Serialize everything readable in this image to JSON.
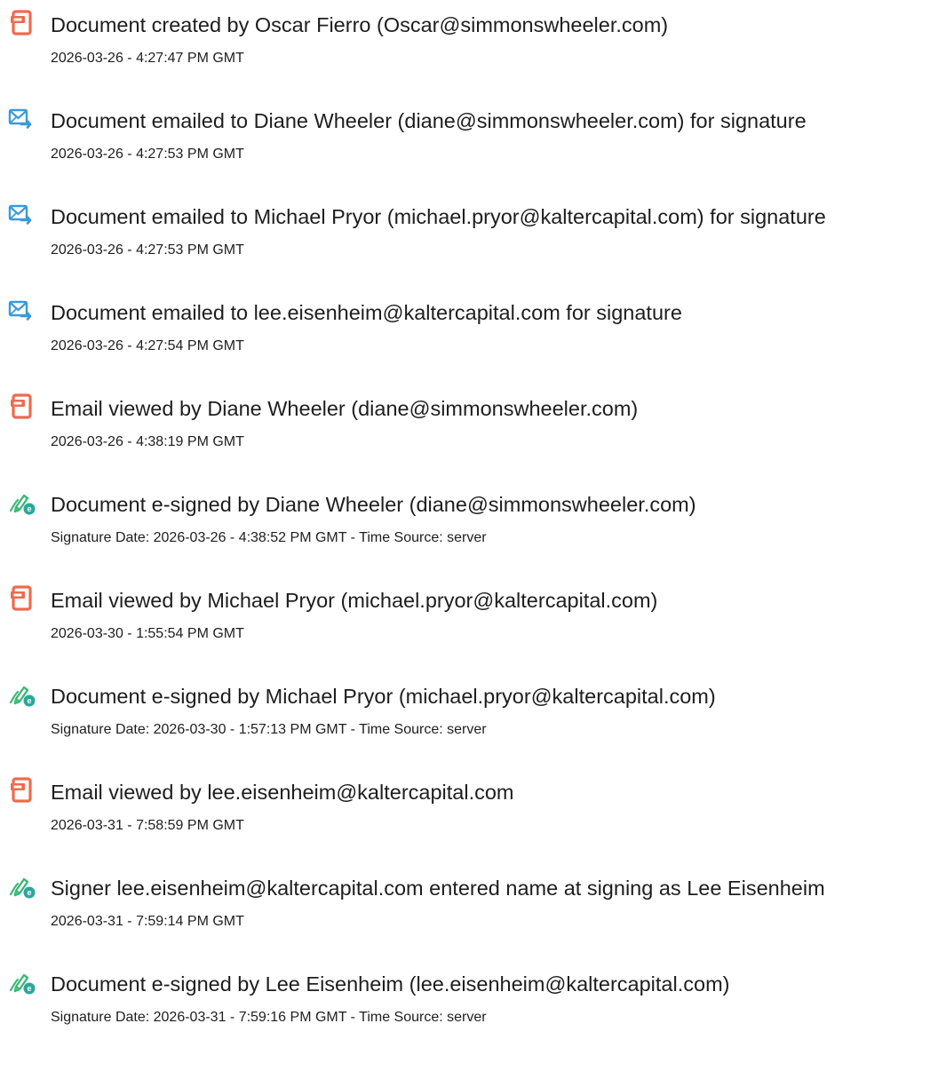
{
  "events": [
    {
      "icon": "document-created-icon",
      "title": "Document created by Oscar Fierro (Oscar@simmonswheeler.com)",
      "detail": "2026-03-26 - 4:27:47 PM GMT"
    },
    {
      "icon": "email-sent-icon",
      "title": "Document emailed to Diane Wheeler (diane@simmonswheeler.com) for signature",
      "detail": "2026-03-26 - 4:27:53 PM GMT"
    },
    {
      "icon": "email-sent-icon",
      "title": "Document emailed to Michael Pryor (michael.pryor@kaltercapital.com) for signature",
      "detail": "2026-03-26 - 4:27:53 PM GMT"
    },
    {
      "icon": "email-sent-icon",
      "title": "Document emailed to lee.eisenheim@kaltercapital.com for signature",
      "detail": "2026-03-26 - 4:27:54 PM GMT"
    },
    {
      "icon": "document-viewed-icon",
      "title": "Email viewed by Diane Wheeler (diane@simmonswheeler.com)",
      "detail": "2026-03-26 - 4:38:19 PM GMT"
    },
    {
      "icon": "e-signed-icon",
      "title": "Document e-signed by Diane Wheeler (diane@simmonswheeler.com)",
      "detail": "Signature Date: 2026-03-26 - 4:38:52 PM GMT - Time Source: server"
    },
    {
      "icon": "document-viewed-icon",
      "title": "Email viewed by Michael Pryor (michael.pryor@kaltercapital.com)",
      "detail": "2026-03-30 - 1:55:54 PM GMT"
    },
    {
      "icon": "e-signed-icon",
      "title": "Document e-signed by Michael Pryor (michael.pryor@kaltercapital.com)",
      "detail": "Signature Date: 2026-03-30 - 1:57:13 PM GMT - Time Source: server"
    },
    {
      "icon": "document-viewed-icon",
      "title": "Email viewed by lee.eisenheim@kaltercapital.com",
      "detail": "2026-03-31 - 7:58:59 PM GMT"
    },
    {
      "icon": "e-signed-icon",
      "title": "Signer lee.eisenheim@kaltercapital.com entered name at signing as Lee Eisenheim",
      "detail": "2026-03-31 - 7:59:14 PM GMT"
    },
    {
      "icon": "e-signed-icon",
      "title": "Document e-signed by Lee Eisenheim (lee.eisenheim@kaltercapital.com)",
      "detail": "Signature Date: 2026-03-31 - 7:59:16 PM GMT - Time Source: server"
    }
  ],
  "colors": {
    "document_icon": "#ee6b4d",
    "email_icon": "#3a9ad9",
    "sign_icon_pen": "#3cb878",
    "sign_icon_badge": "#2aa89a",
    "text": "#1e1e1e"
  }
}
